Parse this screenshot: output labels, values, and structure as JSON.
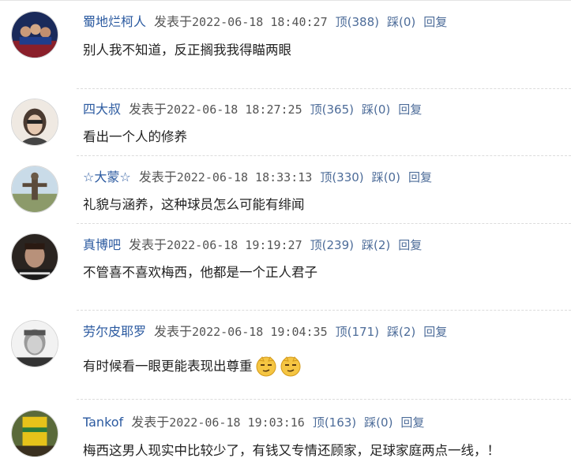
{
  "labels": {
    "posted": "发表于",
    "up": "顶",
    "down": "踩",
    "reply": "回复"
  },
  "comments": [
    {
      "user": "蜀地烂柯人",
      "datetime": "2022-06-18  18:40:27",
      "up": "(388)",
      "down": "(0)",
      "text": "别人我不知道，反正搁我我得瞄两眼"
    },
    {
      "user": "四大叔",
      "datetime": "2022-06-18  18:27:25",
      "up": "(365)",
      "down": "(0)",
      "text": "看出一个人的修养"
    },
    {
      "user": "☆大蒙☆",
      "datetime": "2022-06-18  18:33:13",
      "up": "(330)",
      "down": "(0)",
      "text": "礼貌与涵养，这种球员怎么可能有绯闻"
    },
    {
      "user": "真博吧",
      "datetime": "2022-06-18  19:19:27",
      "up": "(239)",
      "down": "(2)",
      "text": "不管喜不喜欢梅西，他都是一个正人君子"
    },
    {
      "user": "劳尔皮耶罗",
      "datetime": "2022-06-18  19:04:35",
      "up": "(171)",
      "down": "(2)",
      "text": "有时候看一眼更能表现出尊重"
    },
    {
      "user": "Tankof",
      "datetime": "2022-06-18  19:03:16",
      "up": "(163)",
      "down": "(0)",
      "text": "梅西这男人现实中比较少了，有钱又专情还顾家，足球家庭两点一线，！"
    }
  ]
}
